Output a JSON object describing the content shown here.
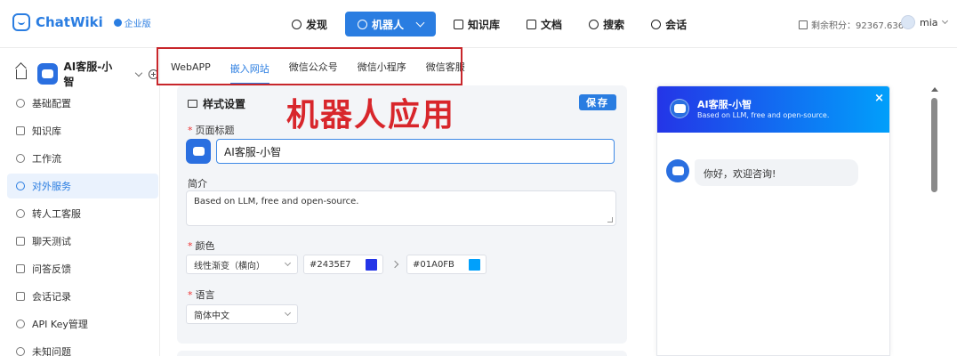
{
  "app": {
    "name": "ChatWiki",
    "edition": "企业版"
  },
  "nav": {
    "items": [
      {
        "label": "发现",
        "active": false
      },
      {
        "label": "机器人",
        "active": true
      },
      {
        "label": "知识库",
        "active": false
      },
      {
        "label": "文档",
        "active": false
      },
      {
        "label": "搜索",
        "active": false
      },
      {
        "label": "会话",
        "active": false
      }
    ],
    "credits": "剩余积分：92367.636",
    "user": "mia"
  },
  "robot": {
    "name": "AI客服-小智"
  },
  "sidebar": {
    "items": [
      {
        "label": "基础配置"
      },
      {
        "label": "知识库"
      },
      {
        "label": "工作流"
      },
      {
        "label": "对外服务",
        "active": true
      },
      {
        "label": "转人工客服"
      },
      {
        "label": "聊天测试"
      },
      {
        "label": "问答反馈"
      },
      {
        "label": "会话记录"
      },
      {
        "label": "API Key管理"
      },
      {
        "label": "未知问题"
      }
    ]
  },
  "tabs": [
    {
      "label": "WebAPP"
    },
    {
      "label": "嵌入网站",
      "active": true
    },
    {
      "label": "微信公众号"
    },
    {
      "label": "微信小程序"
    },
    {
      "label": "微信客服"
    }
  ],
  "annotation": "机器人应用",
  "style_settings": {
    "title": "样式设置",
    "save_label": "保存",
    "page_title_label": "页面标题",
    "page_title_value": "AI客服-小智",
    "intro_label": "简介",
    "intro_value": "Based on LLM, free and open-source.",
    "color_label": "颜色",
    "gradient_mode": "线性渐变（横向）",
    "color_start": "#2435E7",
    "color_end": "#01A0FB",
    "language_label": "语言",
    "language_value": "简体中文"
  },
  "preview": {
    "name": "AI客服-小智",
    "desc": "Based on LLM, free and open-source.",
    "close": "×",
    "greeting": "你好，欢迎咨询!"
  },
  "colors": {
    "primary": "#2a7de1",
    "gradient_start": "#2435E7",
    "gradient_end": "#01A0FB",
    "annotation_red": "#d8262b"
  }
}
